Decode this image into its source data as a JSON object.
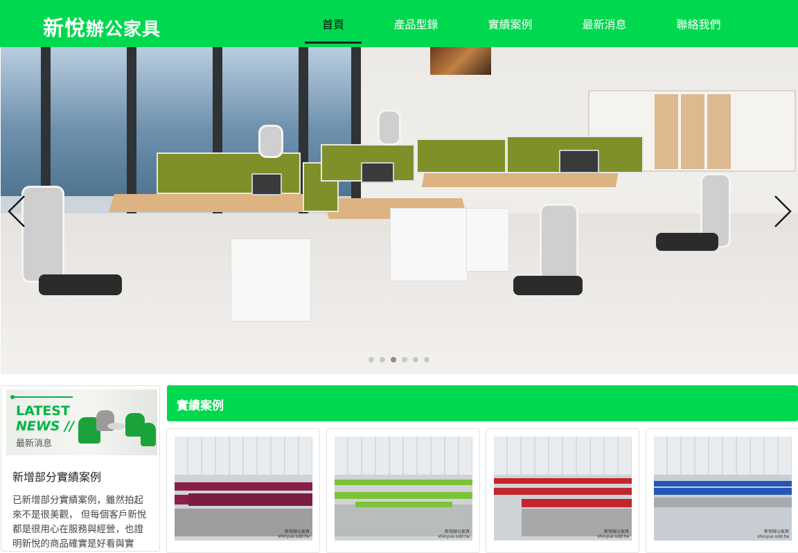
{
  "header": {
    "logo_main": "新悅",
    "logo_sub": "辦公家具",
    "nav": [
      {
        "label": "首頁",
        "active": true
      },
      {
        "label": "產品型錄",
        "active": false
      },
      {
        "label": "實績案例",
        "active": false
      },
      {
        "label": "最新消息",
        "active": false
      },
      {
        "label": "聯絡我們",
        "active": false
      }
    ],
    "brand_color": "#00d94f"
  },
  "hero": {
    "image": "office-workstations-photo",
    "prev_icon": "chevron-left-icon",
    "next_icon": "chevron-right-icon",
    "slide_count": 6,
    "active_slide": 3
  },
  "news": {
    "banner_line1": "LATEST",
    "banner_line2": "NEWS //",
    "banner_line3": "最新消息",
    "title": "新增部分實績案例",
    "body": "已新增部分實績案例，雖然拍起來不是很美觀， 但每個客戶新悅都是很用心在服務與經營，也證明新悅的商品確實是好看與實"
  },
  "cases": {
    "heading": "實績案例",
    "items": [
      {
        "accent": "#8a1f4a",
        "watermark_1": "新悅辦公家具",
        "watermark_2": "shinyue.odd.tw"
      },
      {
        "accent": "#7cc33a",
        "watermark_1": "新悅辦公家具",
        "watermark_2": "shinyue.odd.tw"
      },
      {
        "accent": "#c4242c",
        "watermark_1": "新悅辦公家具",
        "watermark_2": "shinyue.odd.tw"
      },
      {
        "accent": "#2456b8",
        "watermark_1": "新悅辦公家具",
        "watermark_2": "shinyue.odd.tw"
      }
    ]
  }
}
